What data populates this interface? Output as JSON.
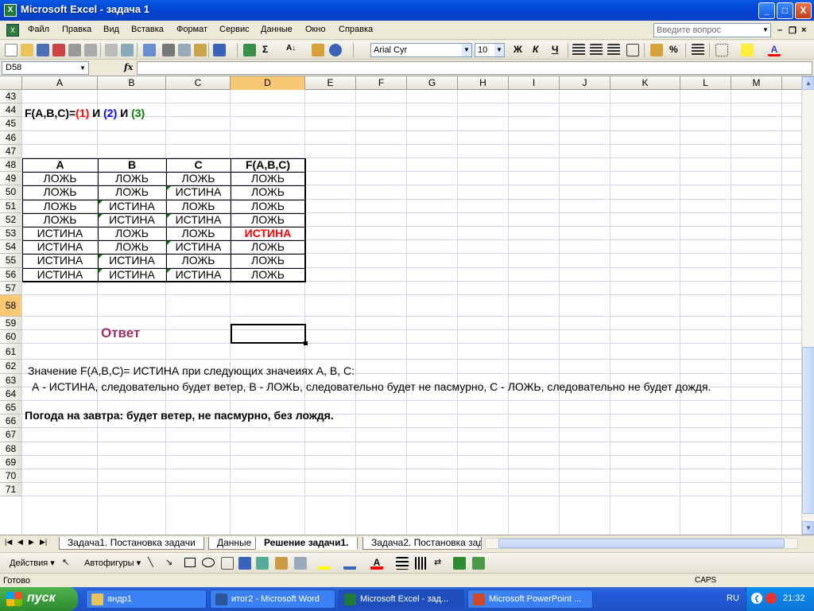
{
  "window": {
    "title": "Microsoft Excel - задача 1",
    "min": "_",
    "max": "□",
    "close": "X"
  },
  "menu": {
    "items": [
      "Файл",
      "Правка",
      "Вид",
      "Вставка",
      "Формат",
      "Сервис",
      "Данные",
      "Окно",
      "Справка"
    ],
    "ask_placeholder": "Введите вопрос",
    "doc_min": "–",
    "doc_restore": "❐",
    "doc_close": "×"
  },
  "toolbar": {
    "font": "Arial Cyr",
    "size": "10",
    "bold": "Ж",
    "italic": "К",
    "underline": "Ч",
    "percent": "%",
    "sum": "Σ",
    "sort": "А↓"
  },
  "formula": {
    "cell_ref": "D58",
    "fx": "fx",
    "value": ""
  },
  "columns": [
    "A",
    "B",
    "C",
    "D",
    "E",
    "F",
    "G",
    "H",
    "I",
    "J",
    "K",
    "L",
    "M"
  ],
  "rows": [
    "43",
    "44",
    "45",
    "46",
    "47",
    "48",
    "49",
    "50",
    "51",
    "52",
    "53",
    "54",
    "55",
    "56",
    "57",
    "58",
    "59",
    "60",
    "61",
    "62",
    "63",
    "64",
    "65",
    "66",
    "67",
    "68",
    "69",
    "70",
    "71"
  ],
  "sheet": {
    "formula_label": "F(A,B,C)=",
    "f1": "(1)",
    "and1": " И ",
    "f2": "(2)",
    "and2": " И ",
    "f3": "(3)",
    "table": {
      "headers": [
        "A",
        "B",
        "C",
        "F(A,B,C)"
      ],
      "rows": [
        [
          "ЛОЖЬ",
          "ЛОЖЬ",
          "ЛОЖЬ",
          "ЛОЖЬ"
        ],
        [
          "ЛОЖЬ",
          "ЛОЖЬ",
          "ИСТИНА",
          "ЛОЖЬ"
        ],
        [
          "ЛОЖЬ",
          "ИСТИНА",
          "ЛОЖЬ",
          "ЛОЖЬ"
        ],
        [
          "ЛОЖЬ",
          "ИСТИНА",
          "ИСТИНА",
          "ЛОЖЬ"
        ],
        [
          "ИСТИНА",
          "ЛОЖЬ",
          "ЛОЖЬ",
          "ИСТИНА"
        ],
        [
          "ИСТИНА",
          "ЛОЖЬ",
          "ИСТИНА",
          "ЛОЖЬ"
        ],
        [
          "ИСТИНА",
          "ИСТИНА",
          "ЛОЖЬ",
          "ЛОЖЬ"
        ],
        [
          "ИСТИНА",
          "ИСТИНА",
          "ИСТИНА",
          "ЛОЖЬ"
        ]
      ]
    },
    "answer_label": "Ответ",
    "line60": "Значение F(A,B,C)= ИСТИНА при следующих значеиях А, В, С:",
    "line61": "А - ИСТИНА, следовательно будет ветер, В - ЛОЖЬ, следовательно будет не пасмурно, С - ЛОЖЬ, следовательно не будет дождя.",
    "line63": "Погода на завтра:  будет ветер, не пасмурно, без лождя.",
    "colors": {
      "red": "#ff0000",
      "blue": "#0000ff",
      "green": "#008000",
      "answer": "#993366"
    }
  },
  "tabs": [
    "Задача1. Постановка задачи",
    "Данные",
    "Решение задачи1.",
    "Задача2. Постановка зад"
  ],
  "drawbar": {
    "actions": "Действия ▾",
    "autoshapes": "Автофигуры ▾"
  },
  "status": {
    "text": "Готово",
    "caps": "CAPS"
  },
  "taskbar": {
    "start": "пуск",
    "tasks": [
      "андр1",
      "итог2 - Microsoft Word",
      "Microsoft Excel - зад...",
      "Microsoft PowerPoint ..."
    ],
    "lang": "RU",
    "time": "21:32"
  }
}
